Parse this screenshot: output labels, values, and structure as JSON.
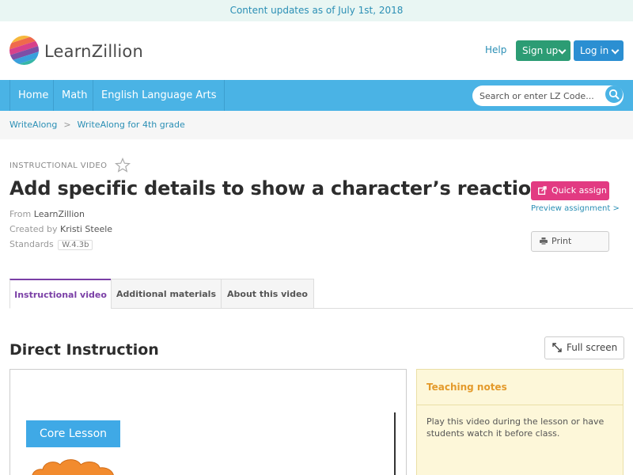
{
  "banner": {
    "text": "Content updates as of July 1st, 2018"
  },
  "header": {
    "brand": "LearnZillion",
    "help": "Help",
    "signup": "Sign up",
    "login": "Log in"
  },
  "nav": {
    "items": [
      "Home",
      "Math",
      "English Language Arts"
    ],
    "search_placeholder": "Search or enter LZ Code..."
  },
  "breadcrumb": {
    "items": [
      "WriteAlong",
      "WriteAlong for 4th grade"
    ],
    "separator": ">"
  },
  "lesson": {
    "kicker": "INSTRUCTIONAL VIDEO",
    "title": "Add specific details to show a character’s reactions",
    "from_label": "From",
    "from_value": "LearnZillion",
    "created_label": "Created by",
    "created_value": "Kristi Steele",
    "standards_label": "Standards",
    "standards_value": "W.4.3b"
  },
  "actions": {
    "quick_assign": "Quick assign",
    "preview": "Preview assignment >",
    "print": "Print"
  },
  "tabs": [
    "Instructional video",
    "Additional materials",
    "About this video"
  ],
  "section": {
    "title": "Direct Instruction",
    "fullscreen": "Full screen"
  },
  "video": {
    "label": "Core Lesson"
  },
  "notes": {
    "title": "Teaching notes",
    "body": "Play this video during the lesson or have students watch it before class."
  },
  "colors": {
    "accent": "#4ab3e5",
    "signup": "#2c9c74",
    "login": "#2b8fd2",
    "quick_assign": "#e23a82",
    "active_tab": "#7a3fa6",
    "notes_title": "#e49a2b"
  }
}
